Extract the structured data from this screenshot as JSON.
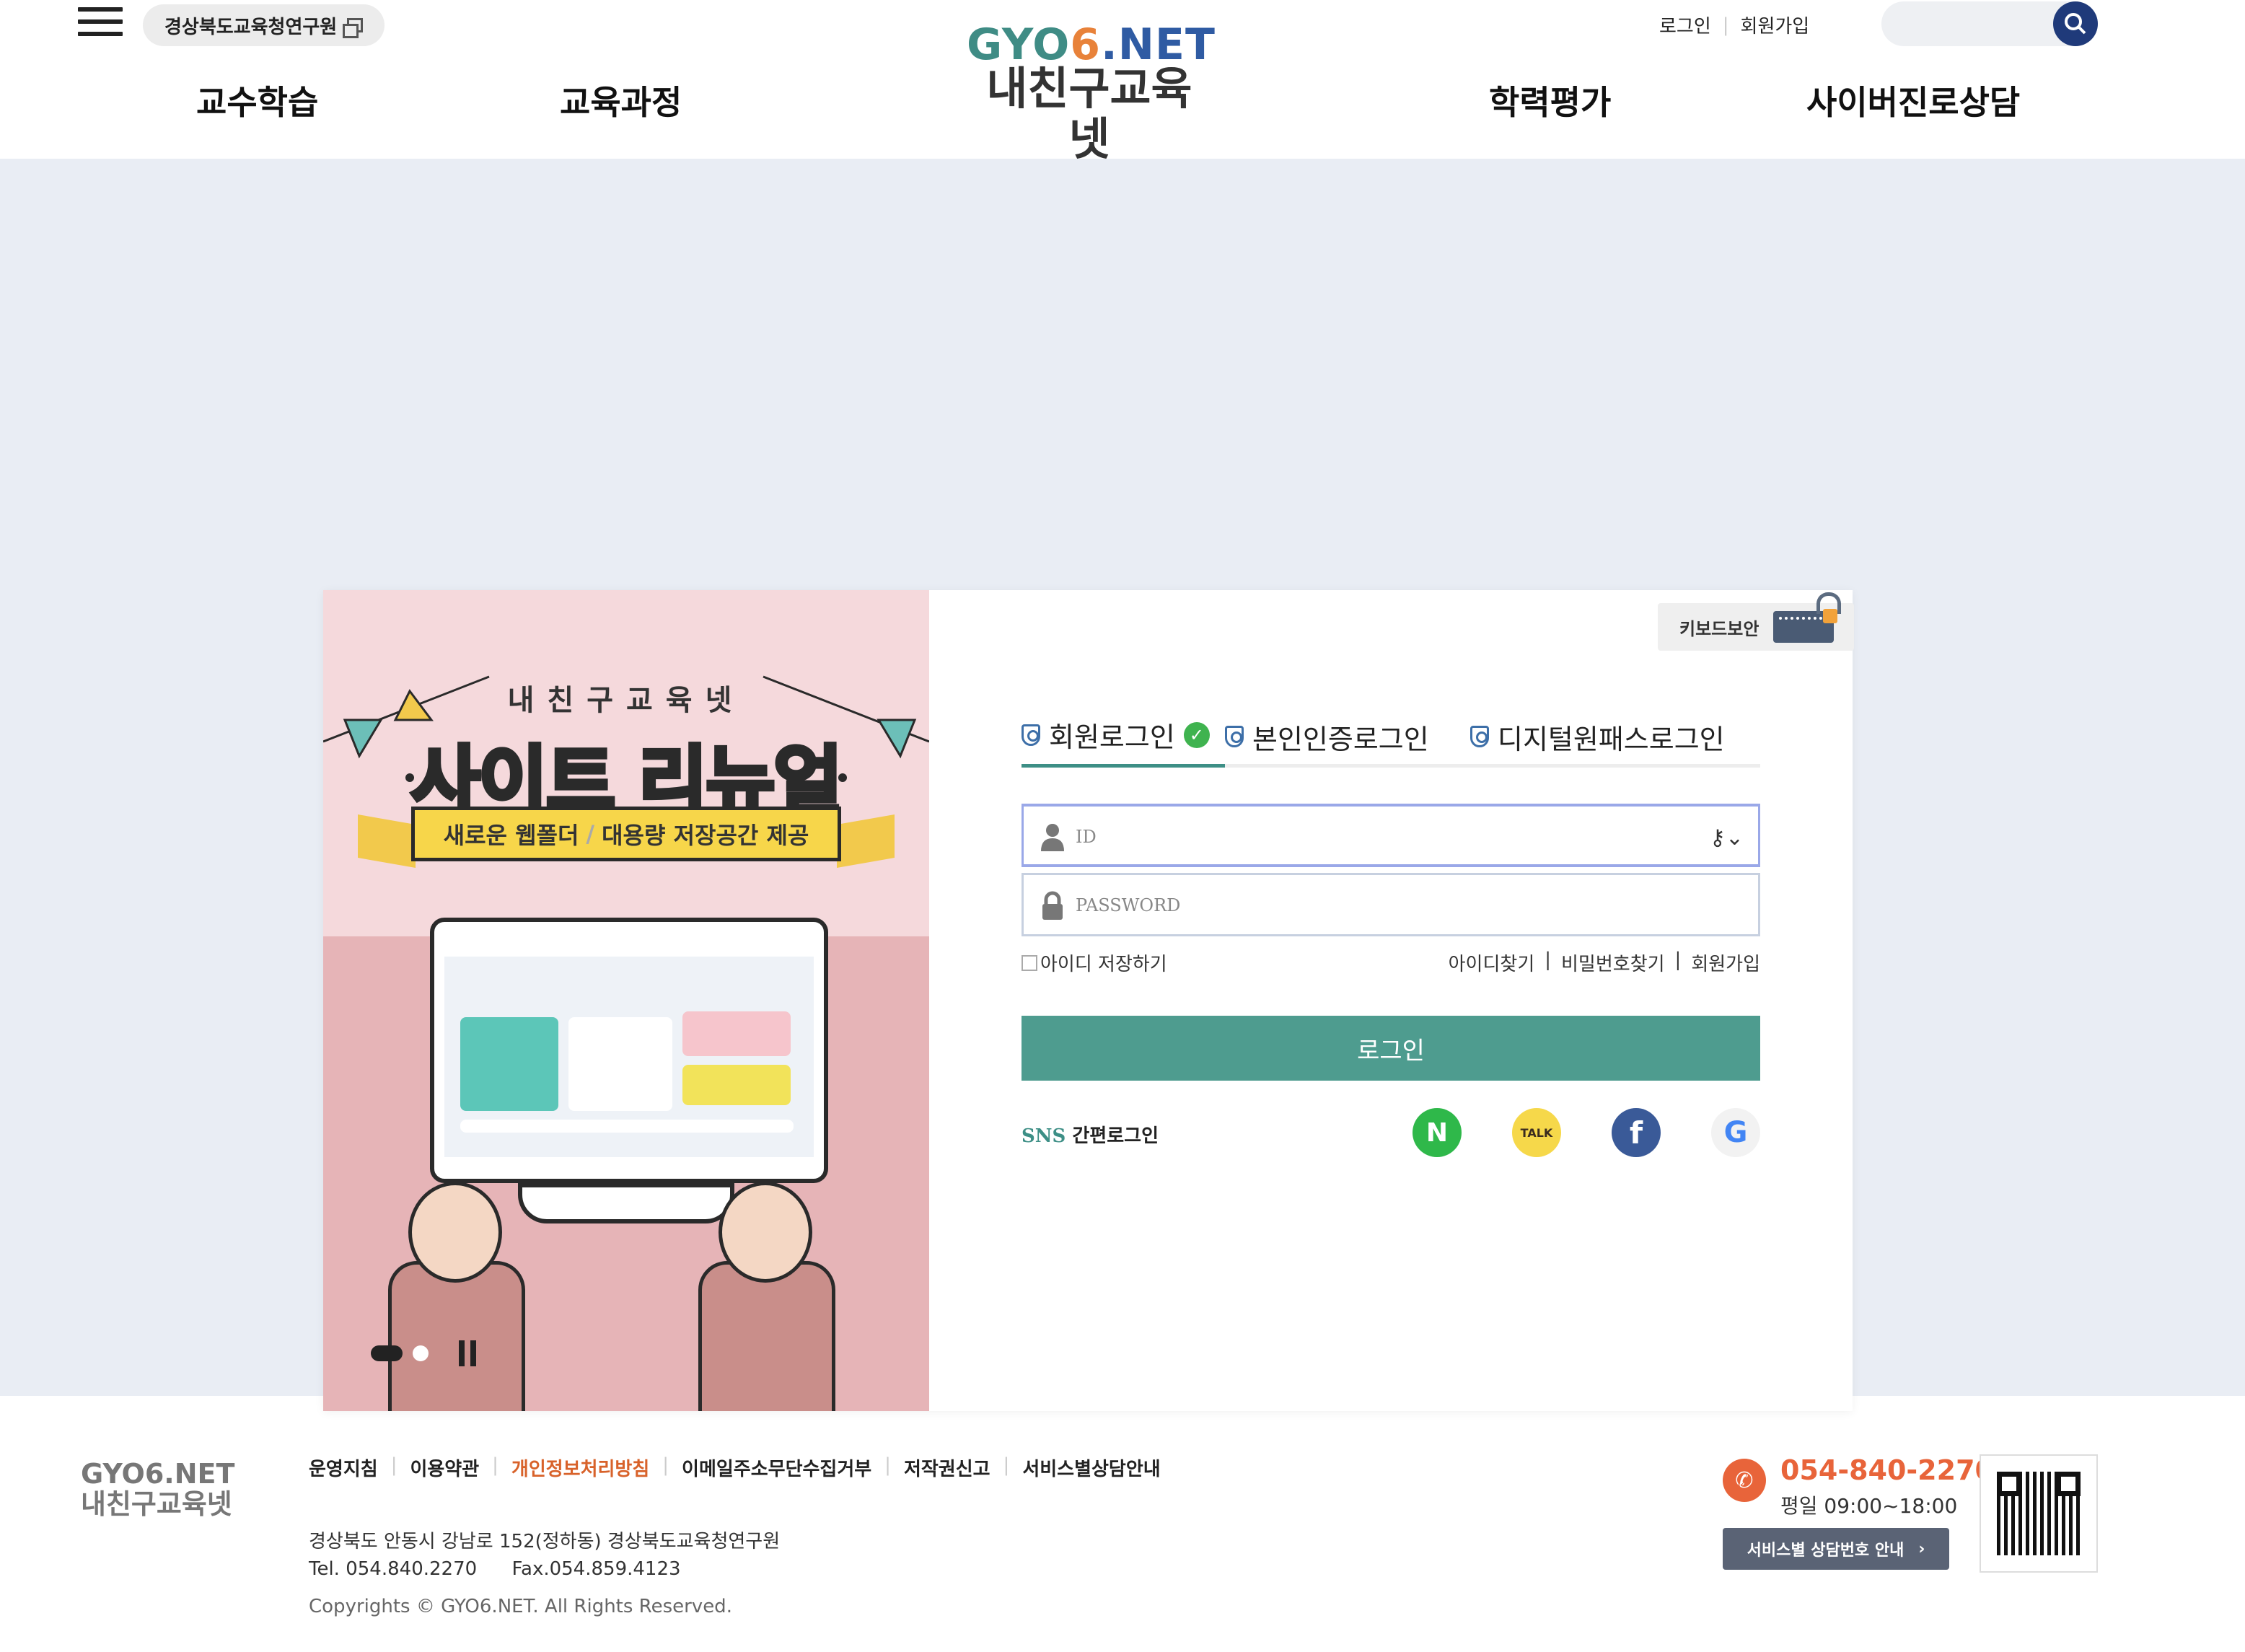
{
  "header": {
    "org_pill": "경상북도교육청연구원",
    "logo_en_g": "GYO",
    "logo_en_o": "6",
    "logo_en_n": ".NET",
    "logo_ko": "내친구교육넷",
    "login_link": "로그인",
    "signup_link": "회원가입",
    "search_placeholder": "",
    "nav": [
      "교수학습",
      "교육과정",
      "학력평가",
      "사이버진로상담"
    ]
  },
  "banner": {
    "small_title": "내친구교육넷",
    "big_title_white": "사이트",
    "big_title_red": "리뉴얼",
    "ribbon_left": "새로운 웹폴더",
    "ribbon_sep": "/",
    "ribbon_right": "대용량 저장공간 제공"
  },
  "login": {
    "keyboard_security": "키보드보안",
    "tabs": [
      "회원로그인",
      "본인인증로그인",
      "디지털원패스로그인"
    ],
    "active_tab": 0,
    "id_placeholder": "ID",
    "pw_placeholder": "PASSWORD",
    "save_id": "아이디 저장하기",
    "find_id": "아이디찾기",
    "find_pw": "비밀번호찾기",
    "join": "회원가입",
    "login_button": "로그인",
    "sns_prefix": "SNS",
    "sns_suffix": "간편로그인",
    "sns_providers": [
      "naver",
      "kakao",
      "facebook",
      "google"
    ]
  },
  "footer": {
    "logo_en": "GYO6.NET",
    "logo_ko": "내친구교육넷",
    "links": [
      "운영지침",
      "이용약관",
      "개인정보처리방침",
      "이메일주소무단수집거부",
      "저작권신고",
      "서비스별상담안내"
    ],
    "address": "경상북도 안동시 강남로 152(정하동) 경상북도교육청연구원",
    "tel": "Tel. 054.840.2270",
    "fax": "Fax.054.859.4123",
    "copyright": "Copyrights © GYO6.NET. All Rights Reserved.",
    "phone": "054-840-2270",
    "hours": "평일 09:00~18:00",
    "service_button": "서비스별 상담번호 안내"
  },
  "colors": {
    "accent_teal": "#4e9c8f",
    "nav_blue": "#1f3a7a",
    "footer_orange": "#e8643a",
    "page_bg": "#e9edf4"
  }
}
